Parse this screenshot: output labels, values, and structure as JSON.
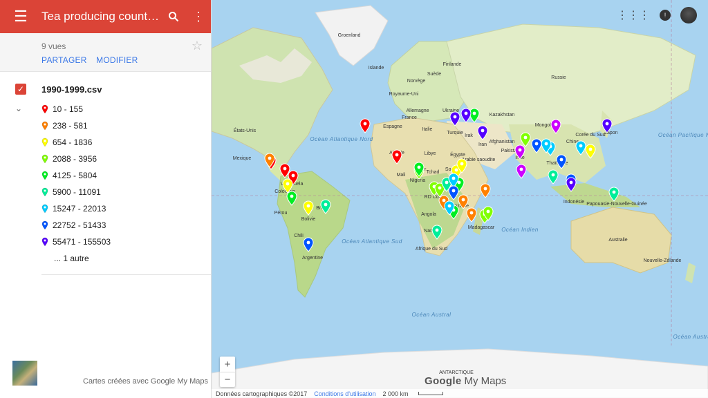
{
  "sidebar": {
    "title": "Tea producing countrie…",
    "views": "9 vues",
    "share_label": "PARTAGER",
    "edit_label": "MODIFIER",
    "layer": {
      "name": "1990-1999.csv",
      "legend": [
        {
          "label": "10 - 155",
          "color": "#ff0000"
        },
        {
          "label": "238 - 581",
          "color": "#ff8000"
        },
        {
          "label": "654 - 1836",
          "color": "#ffff00"
        },
        {
          "label": "2088 - 3956",
          "color": "#80ff00"
        },
        {
          "label": "4125 - 5804",
          "color": "#00ee22"
        },
        {
          "label": "5900 - 11091",
          "color": "#00ee99"
        },
        {
          "label": "15247 - 22013",
          "color": "#00ccff"
        },
        {
          "label": "22752 - 51433",
          "color": "#0055ff"
        },
        {
          "label": "55471 - 155503",
          "color": "#5500ff"
        }
      ],
      "more": "... 1 autre"
    },
    "credit": "Cartes créées avec Google My Maps"
  },
  "map": {
    "labels": [
      {
        "text": "Groenland",
        "type": "country"
      },
      {
        "text": "Islande",
        "type": "country"
      },
      {
        "text": "Norvège",
        "type": "country"
      },
      {
        "text": "Suède",
        "type": "country"
      },
      {
        "text": "Finlande",
        "type": "country"
      },
      {
        "text": "Royaume-Uni",
        "type": "country"
      },
      {
        "text": "Allemagne",
        "type": "country"
      },
      {
        "text": "Ukraine",
        "type": "country"
      },
      {
        "text": "France",
        "type": "country"
      },
      {
        "text": "Espagne",
        "type": "country"
      },
      {
        "text": "Italie",
        "type": "country"
      },
      {
        "text": "Russie",
        "type": "country"
      },
      {
        "text": "Kazakhstan",
        "type": "country"
      },
      {
        "text": "Mongolie",
        "type": "country"
      },
      {
        "text": "Chine",
        "type": "country"
      },
      {
        "text": "Japon",
        "type": "country"
      },
      {
        "text": "Corée du Sud",
        "type": "country"
      },
      {
        "text": "Turquie",
        "type": "country"
      },
      {
        "text": "Irak",
        "type": "country"
      },
      {
        "text": "Iran",
        "type": "country"
      },
      {
        "text": "Afghanistan",
        "type": "country"
      },
      {
        "text": "Pakistan",
        "type": "country"
      },
      {
        "text": "Inde",
        "type": "country"
      },
      {
        "text": "Arabie saoudite",
        "type": "country"
      },
      {
        "text": "Algérie",
        "type": "country"
      },
      {
        "text": "Libye",
        "type": "country"
      },
      {
        "text": "Égypte",
        "type": "country"
      },
      {
        "text": "Mali",
        "type": "country"
      },
      {
        "text": "Niger",
        "type": "country"
      },
      {
        "text": "Tchad",
        "type": "country"
      },
      {
        "text": "Soudan",
        "type": "country"
      },
      {
        "text": "Nigeria",
        "type": "country"
      },
      {
        "text": "RD Congo",
        "type": "country"
      },
      {
        "text": "Tanzanie",
        "type": "country"
      },
      {
        "text": "Angola",
        "type": "country"
      },
      {
        "text": "Namibie",
        "type": "country"
      },
      {
        "text": "Madagascar",
        "type": "country"
      },
      {
        "text": "Afrique du Sud",
        "type": "country"
      },
      {
        "text": "Thaïlande",
        "type": "country"
      },
      {
        "text": "Indonésie",
        "type": "country"
      },
      {
        "text": "Papouasie-Nouvelle-Guinée",
        "type": "country"
      },
      {
        "text": "Australie",
        "type": "country"
      },
      {
        "text": "Nouvelle-Zélande",
        "type": "country"
      },
      {
        "text": "États-Unis",
        "type": "country"
      },
      {
        "text": "Mexique",
        "type": "country"
      },
      {
        "text": "Venezuela",
        "type": "country"
      },
      {
        "text": "Colombie",
        "type": "country"
      },
      {
        "text": "Pérou",
        "type": "country"
      },
      {
        "text": "Brésil",
        "type": "country"
      },
      {
        "text": "Bolivie",
        "type": "country"
      },
      {
        "text": "Chili",
        "type": "country"
      },
      {
        "text": "Argentine",
        "type": "country"
      },
      {
        "text": "Océan Atlantique Nord",
        "type": "ocean"
      },
      {
        "text": "Océan Atlantique Sud",
        "type": "ocean"
      },
      {
        "text": "Océan Indien",
        "type": "ocean"
      },
      {
        "text": "Océan Austral",
        "type": "ocean"
      },
      {
        "text": "Océan Pacifique Nord",
        "type": "ocean"
      },
      {
        "text": "Océan Austral",
        "type": "ocean"
      },
      {
        "text": "ANTARCTIQUE",
        "type": "country"
      }
    ],
    "markers": [
      {
        "c": "#ff0000"
      },
      {
        "c": "#ff0000"
      },
      {
        "c": "#ff0000"
      },
      {
        "c": "#ff0000"
      },
      {
        "c": "#ff0000"
      },
      {
        "c": "#ff8000"
      },
      {
        "c": "#ff8000"
      },
      {
        "c": "#ff8000"
      },
      {
        "c": "#ff8000"
      },
      {
        "c": "#ff8000"
      },
      {
        "c": "#ffff00"
      },
      {
        "c": "#ffff00"
      },
      {
        "c": "#ffff00"
      },
      {
        "c": "#ffff00"
      },
      {
        "c": "#ffff00"
      },
      {
        "c": "#80ff00"
      },
      {
        "c": "#80ff00"
      },
      {
        "c": "#80ff00"
      },
      {
        "c": "#80ff00"
      },
      {
        "c": "#80ff00"
      },
      {
        "c": "#80ff00"
      },
      {
        "c": "#00ee22"
      },
      {
        "c": "#00ee22"
      },
      {
        "c": "#00ee22"
      },
      {
        "c": "#00ee22"
      },
      {
        "c": "#00ee22"
      },
      {
        "c": "#00ee99"
      },
      {
        "c": "#00ee99"
      },
      {
        "c": "#00ee99"
      },
      {
        "c": "#00ee99"
      },
      {
        "c": "#00ee99"
      },
      {
        "c": "#00ccff"
      },
      {
        "c": "#00ccff"
      },
      {
        "c": "#00ccff"
      },
      {
        "c": "#00ccff"
      },
      {
        "c": "#00ccff"
      },
      {
        "c": "#0055ff"
      },
      {
        "c": "#0055ff"
      },
      {
        "c": "#0055ff"
      },
      {
        "c": "#0055ff"
      },
      {
        "c": "#0055ff"
      },
      {
        "c": "#5500ff"
      },
      {
        "c": "#5500ff"
      },
      {
        "c": "#5500ff"
      },
      {
        "c": "#5500ff"
      },
      {
        "c": "#5500ff"
      },
      {
        "c": "#cc00ff"
      },
      {
        "c": "#cc00ff"
      },
      {
        "c": "#cc00ff"
      }
    ],
    "footer": {
      "data": "Données cartographiques ©2017",
      "terms": "Conditions d'utilisation",
      "scale": "2 000 km"
    },
    "logo_google": "Google",
    "logo_mymaps": "My Maps"
  }
}
